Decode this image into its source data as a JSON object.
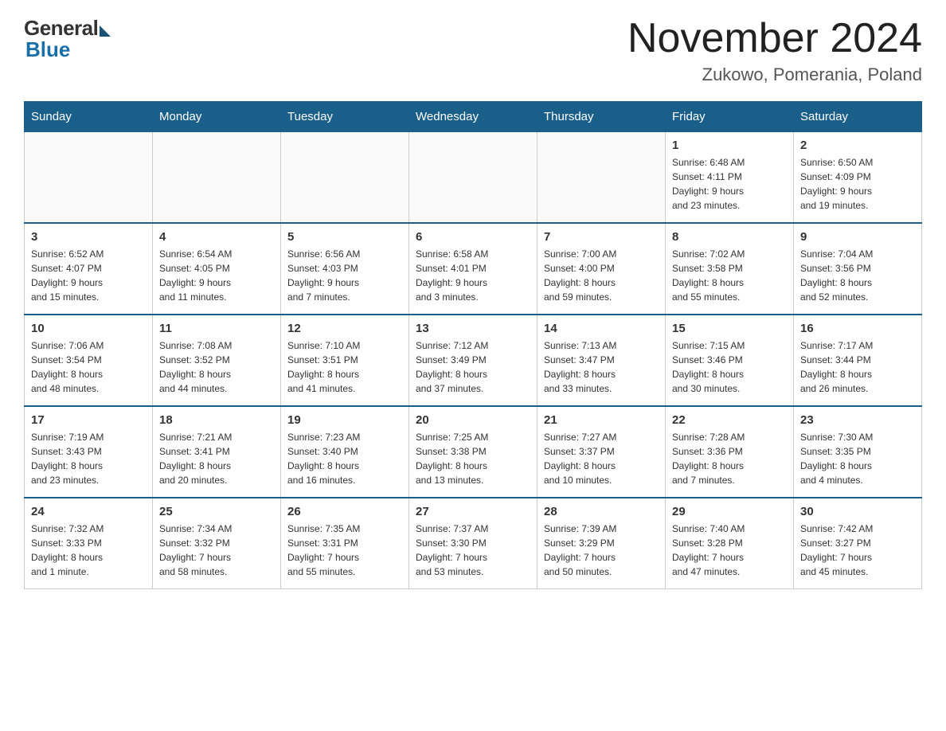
{
  "header": {
    "logo_general": "General",
    "logo_blue": "Blue",
    "month_title": "November 2024",
    "location": "Zukowo, Pomerania, Poland"
  },
  "calendar": {
    "days_of_week": [
      "Sunday",
      "Monday",
      "Tuesday",
      "Wednesday",
      "Thursday",
      "Friday",
      "Saturday"
    ],
    "weeks": [
      [
        {
          "day": "",
          "info": ""
        },
        {
          "day": "",
          "info": ""
        },
        {
          "day": "",
          "info": ""
        },
        {
          "day": "",
          "info": ""
        },
        {
          "day": "",
          "info": ""
        },
        {
          "day": "1",
          "info": "Sunrise: 6:48 AM\nSunset: 4:11 PM\nDaylight: 9 hours\nand 23 minutes."
        },
        {
          "day": "2",
          "info": "Sunrise: 6:50 AM\nSunset: 4:09 PM\nDaylight: 9 hours\nand 19 minutes."
        }
      ],
      [
        {
          "day": "3",
          "info": "Sunrise: 6:52 AM\nSunset: 4:07 PM\nDaylight: 9 hours\nand 15 minutes."
        },
        {
          "day": "4",
          "info": "Sunrise: 6:54 AM\nSunset: 4:05 PM\nDaylight: 9 hours\nand 11 minutes."
        },
        {
          "day": "5",
          "info": "Sunrise: 6:56 AM\nSunset: 4:03 PM\nDaylight: 9 hours\nand 7 minutes."
        },
        {
          "day": "6",
          "info": "Sunrise: 6:58 AM\nSunset: 4:01 PM\nDaylight: 9 hours\nand 3 minutes."
        },
        {
          "day": "7",
          "info": "Sunrise: 7:00 AM\nSunset: 4:00 PM\nDaylight: 8 hours\nand 59 minutes."
        },
        {
          "day": "8",
          "info": "Sunrise: 7:02 AM\nSunset: 3:58 PM\nDaylight: 8 hours\nand 55 minutes."
        },
        {
          "day": "9",
          "info": "Sunrise: 7:04 AM\nSunset: 3:56 PM\nDaylight: 8 hours\nand 52 minutes."
        }
      ],
      [
        {
          "day": "10",
          "info": "Sunrise: 7:06 AM\nSunset: 3:54 PM\nDaylight: 8 hours\nand 48 minutes."
        },
        {
          "day": "11",
          "info": "Sunrise: 7:08 AM\nSunset: 3:52 PM\nDaylight: 8 hours\nand 44 minutes."
        },
        {
          "day": "12",
          "info": "Sunrise: 7:10 AM\nSunset: 3:51 PM\nDaylight: 8 hours\nand 41 minutes."
        },
        {
          "day": "13",
          "info": "Sunrise: 7:12 AM\nSunset: 3:49 PM\nDaylight: 8 hours\nand 37 minutes."
        },
        {
          "day": "14",
          "info": "Sunrise: 7:13 AM\nSunset: 3:47 PM\nDaylight: 8 hours\nand 33 minutes."
        },
        {
          "day": "15",
          "info": "Sunrise: 7:15 AM\nSunset: 3:46 PM\nDaylight: 8 hours\nand 30 minutes."
        },
        {
          "day": "16",
          "info": "Sunrise: 7:17 AM\nSunset: 3:44 PM\nDaylight: 8 hours\nand 26 minutes."
        }
      ],
      [
        {
          "day": "17",
          "info": "Sunrise: 7:19 AM\nSunset: 3:43 PM\nDaylight: 8 hours\nand 23 minutes."
        },
        {
          "day": "18",
          "info": "Sunrise: 7:21 AM\nSunset: 3:41 PM\nDaylight: 8 hours\nand 20 minutes."
        },
        {
          "day": "19",
          "info": "Sunrise: 7:23 AM\nSunset: 3:40 PM\nDaylight: 8 hours\nand 16 minutes."
        },
        {
          "day": "20",
          "info": "Sunrise: 7:25 AM\nSunset: 3:38 PM\nDaylight: 8 hours\nand 13 minutes."
        },
        {
          "day": "21",
          "info": "Sunrise: 7:27 AM\nSunset: 3:37 PM\nDaylight: 8 hours\nand 10 minutes."
        },
        {
          "day": "22",
          "info": "Sunrise: 7:28 AM\nSunset: 3:36 PM\nDaylight: 8 hours\nand 7 minutes."
        },
        {
          "day": "23",
          "info": "Sunrise: 7:30 AM\nSunset: 3:35 PM\nDaylight: 8 hours\nand 4 minutes."
        }
      ],
      [
        {
          "day": "24",
          "info": "Sunrise: 7:32 AM\nSunset: 3:33 PM\nDaylight: 8 hours\nand 1 minute."
        },
        {
          "day": "25",
          "info": "Sunrise: 7:34 AM\nSunset: 3:32 PM\nDaylight: 7 hours\nand 58 minutes."
        },
        {
          "day": "26",
          "info": "Sunrise: 7:35 AM\nSunset: 3:31 PM\nDaylight: 7 hours\nand 55 minutes."
        },
        {
          "day": "27",
          "info": "Sunrise: 7:37 AM\nSunset: 3:30 PM\nDaylight: 7 hours\nand 53 minutes."
        },
        {
          "day": "28",
          "info": "Sunrise: 7:39 AM\nSunset: 3:29 PM\nDaylight: 7 hours\nand 50 minutes."
        },
        {
          "day": "29",
          "info": "Sunrise: 7:40 AM\nSunset: 3:28 PM\nDaylight: 7 hours\nand 47 minutes."
        },
        {
          "day": "30",
          "info": "Sunrise: 7:42 AM\nSunset: 3:27 PM\nDaylight: 7 hours\nand 45 minutes."
        }
      ]
    ]
  }
}
